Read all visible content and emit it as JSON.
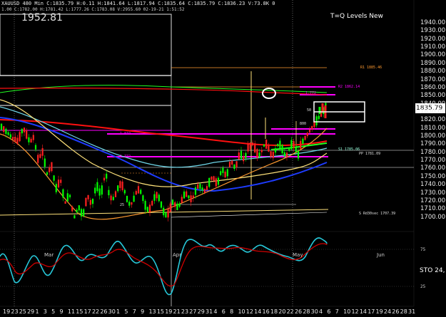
{
  "header": {
    "line1": "XAUUSD 480 Min  C:1835.79  H:0.11  H:1841.64  L:1817.94  C:1835.64  C:1835.79  C:1836.23  V:73.8K  0",
    "line2": "1.00  C:1782.00  H:1781.42  L:1777.26  C:1783.08  V:2955.60  02-19-21 1:51:52",
    "big_price": "1952.81"
  },
  "title": "T=Q Levels New",
  "current_price": "1835.79",
  "price_axis": [
    "1940.00",
    "1930.00",
    "1920.00",
    "1910.00",
    "1900.00",
    "1890.00",
    "1880.00",
    "1870.00",
    "1860.00",
    "1850.00",
    "1840.00",
    "1830.00",
    "1820.00",
    "1810.00",
    "1800.00",
    "1790.00",
    "1780.00",
    "1770.00",
    "1760.00",
    "1750.00",
    "1740.00",
    "1730.00",
    "1720.00",
    "1710.00",
    "1700.00"
  ],
  "date_axis": [
    "19",
    "23",
    "25",
    "29",
    "1",
    "3",
    "5",
    "9",
    "11",
    "15",
    "17",
    "22",
    "26",
    "30",
    "1",
    "5",
    "7",
    "9",
    "13",
    "15",
    "19",
    "21",
    "23",
    "27",
    "29",
    "31",
    "4",
    "6",
    "8",
    "10",
    "12",
    "14",
    "16",
    "18",
    "20",
    "22",
    "26",
    "28",
    "30",
    "4",
    "6",
    "7",
    "10",
    "12",
    "14",
    "17",
    "19",
    "24",
    "26",
    "28",
    "31"
  ],
  "month_labels": [
    "Mar",
    "Apr",
    "May",
    "Jun"
  ],
  "level_labels": {
    "r1": "R1  1885.46",
    "r2": "R2  1862.14",
    "s1": "S1  1785.06",
    "pivot": "PP  1781.09",
    "s2": "S Rd30sec  1707.39"
  },
  "small_labels": [
    "1.772",
    "1.772",
    "1.819",
    "800",
    "1.6",
    "1.0",
    "50",
    "25",
    "900"
  ],
  "oscillator": {
    "label": "STO 24,",
    "upper_level": "75",
    "lower_level": "25"
  },
  "colors": {
    "background": "#000000",
    "candle_up": "#00ff00",
    "candle_down": "#ff2020",
    "ma_red": "#ff1010",
    "ma_blue": "#1e3cff",
    "ma_cyan": "#6fd6e8",
    "ma_yellow": "#ffe27a",
    "ma_orange": "#ff9a30",
    "ma_green": "#22ff22",
    "level_magenta": "#ff00ff",
    "stoch_k": "#27c7d8",
    "stoch_d": "#d00000"
  }
}
